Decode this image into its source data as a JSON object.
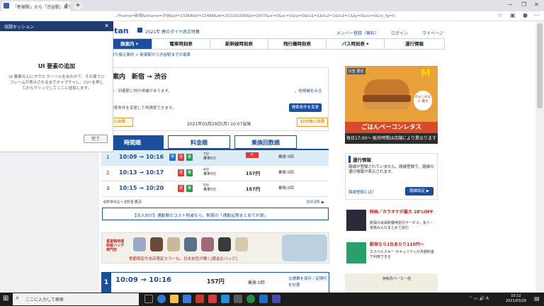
{
  "browser": {
    "tab_title": "「新宿駅」から「渋谷駅」乗り換え案内",
    "url": "...?fname=新宿&tlname=渋谷&sf=23368&tf=22488&dt=202103290&tt=1007&or=0&sc=1&rp=0&tu1=1&tu2=1&tu3=1&tp=0&sv=0&cs_fg=0"
  },
  "panel": {
    "title": "収録セッション",
    "heading": "UI 要素の追加",
    "description": "UI 要素の上にマウス カーソルを合わせて、その周りにフレームが表示されるまでキャプチャし、Ctrl を押してからクリックしてここに追加します。",
    "done": "完了"
  },
  "site": {
    "logo": "kitan",
    "promo": "2021年 春のダイヤ改正特集",
    "register": "メンバー登録（無料）",
    "login": "ログイン",
    "mypage": "マイページ",
    "nav": [
      "換案内 ▾",
      "電車時刻表",
      "新幹線時刻表",
      "飛行機時刻表",
      "バス時刻表 ▾",
      "運行情報"
    ],
    "breadcrumb": "> 乗り換え案内 > 新宿駅から渋谷駅までの電車"
  },
  "search": {
    "title": "換案内　新宿 → 渋谷",
    "route_note": "出発／到着駅に他の候補があります。",
    "other_candidates": "⌄ 他候補をみる",
    "cond_note": "や検索条件を変更して再検索できます。",
    "cond_button": "検索条件を変更",
    "prev": "前に出発",
    "next": "10分後に出発",
    "departure": "2021年03月29日(月) 10:07出発"
  },
  "tabs": [
    "時間順",
    "料金順",
    "乗換回数順"
  ],
  "results": [
    {
      "n": "1",
      "time": "10:09 → 10:16",
      "badges": [
        "早",
        "安",
        "楽"
      ],
      "min": "7分",
      "sub": "乗車6分",
      "fare": "IC",
      "xfer": "乗換 0回"
    },
    {
      "n": "2",
      "time": "10:13 → 10:17",
      "badges": [
        "安",
        "楽"
      ],
      "min": "4分",
      "sub": "乗車4分",
      "fare": "157円",
      "xfer": "乗換 0回"
    },
    {
      "n": "3",
      "time": "10:15 → 10:20",
      "badges": [
        "安",
        "楽"
      ],
      "min": "5分",
      "sub": "乗車5分",
      "fare": "157円",
      "xfer": "乗換 0回"
    }
  ],
  "count": "6件中の1〜3件を表示",
  "next_page": "次の3件 ▶",
  "pitch": "【法人向け】通勤費のコスト削減なら、駅探の「通勤定期まとめて計算」",
  "bag_ad": {
    "left": "皇室御用達 和装バッグ専門店",
    "text": "季節限定や本店限定カラーも。日本女性が輝く[黄金比バッグ]"
  },
  "detail": {
    "n": "1",
    "time": "10:09 → 10:16",
    "fare": "157円",
    "xfer": "乗換 0回",
    "save": "交通費を保存 / 定期代を計算"
  },
  "right": {
    "ad_label": "広告 限定",
    "m": "M",
    "bubble": "かもしれない 最大",
    "ad_title": "ごはんベーコンレタス",
    "ad_time": "毎日17:00〜 販売時間は店舗により異なります",
    "unkou_h": "運行情報",
    "unkou_t": "路線が登録されていません。路線登録で、路線の運行情報が表示されます。",
    "unkou_q": "路線登録とは？",
    "unkou_b": "路線設定 ▶",
    "ad1_h": "映画／カラオケが最大 28%OFF",
    "ad1_b": "駅探の会員制優待割引サービス。友人・家族みんなまとめて割引",
    "ad2_h": "駅探なら1台あたり110円〜",
    "ad2_b": "カスペルスキー セキュリティが月額料金で利用できる",
    "bot_t": "伊勢丹ベーカー他"
  },
  "taskbar": {
    "search": "ここに入力して検索",
    "time": "10:12",
    "date": "2021/03/29"
  },
  "colors": {
    "brand": "#1b4f9c",
    "accent": "#e53838",
    "panel": "#1f3b72"
  }
}
